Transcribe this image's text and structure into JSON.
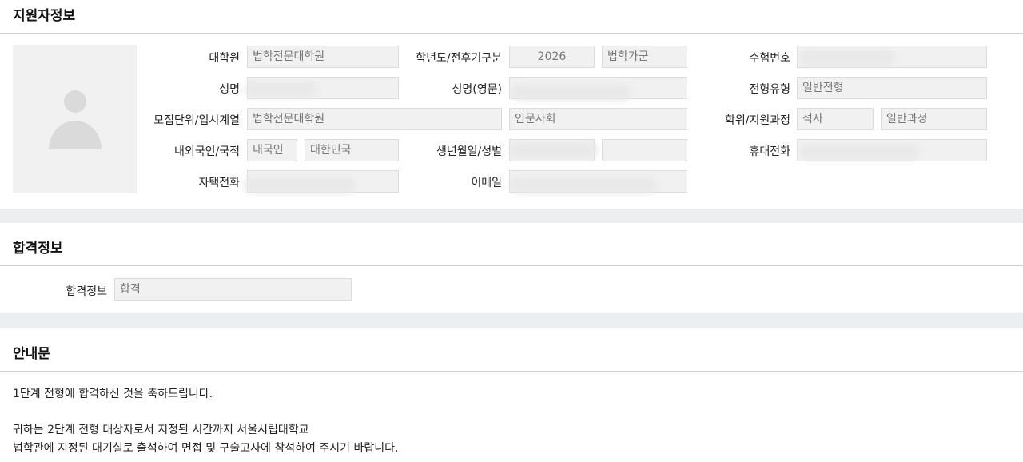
{
  "applicant": {
    "title": "지원자정보",
    "rows": {
      "graduate_school": {
        "label": "대학원",
        "value": "법학전문대학원"
      },
      "year_transfer": {
        "label": "학년도/전후기구분",
        "year": "2026",
        "term": "법학가군"
      },
      "exam_number": {
        "label": "수험번호",
        "value": ""
      },
      "name": {
        "label": "성명",
        "value": ""
      },
      "name_en": {
        "label": "성명(영문)",
        "value": ""
      },
      "admission_type": {
        "label": "전형유형",
        "value": "일반전형"
      },
      "unit": {
        "label": "모집단위/입시계열",
        "value": "법학전문대학원",
        "track": "인문사회"
      },
      "degree": {
        "label": "학위/지원과정",
        "degree": "석사",
        "course": "일반과정"
      },
      "nationality": {
        "label": "내외국인/국적",
        "type": "내국인",
        "country": "대한민국"
      },
      "birth_gender": {
        "label": "생년월일/성별",
        "birth": "",
        "gender": ""
      },
      "mobile": {
        "label": "휴대전화",
        "value": ""
      },
      "home_phone": {
        "label": "자택전화",
        "value": ""
      },
      "email": {
        "label": "이메일",
        "value": ""
      }
    }
  },
  "result": {
    "title": "합격정보",
    "label": "합격정보",
    "value": "합격"
  },
  "notice": {
    "title": "안내문",
    "line1": "1단계 전형에 합격하신 것을 축하드립니다.",
    "line2": "귀하는 2단계 전형 대상자로서 지정된 시간까지 서울시립대학교",
    "line3": "법학관에 지정된 대기실로 출석하여 면접 및 구술고사에 참석하여 주시기 바랍니다."
  }
}
